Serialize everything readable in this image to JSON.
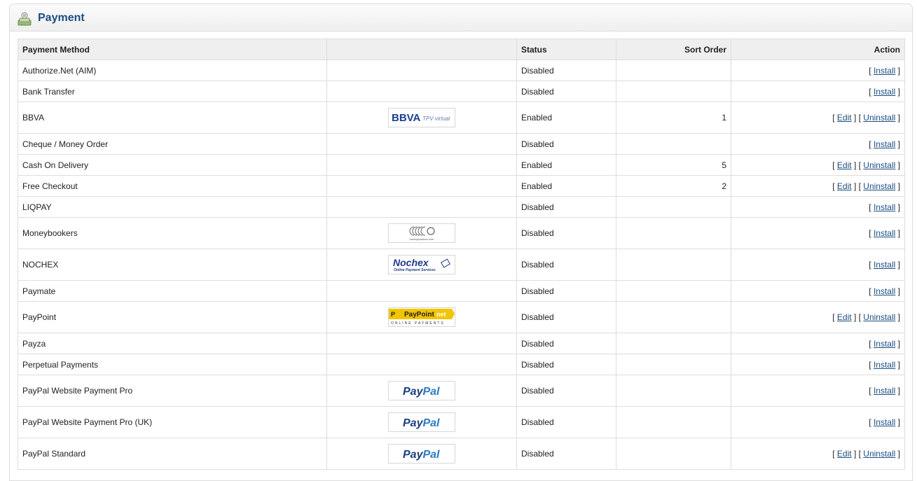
{
  "heading": {
    "title": "Payment"
  },
  "table": {
    "columns": [
      "Payment Method",
      "",
      "Status",
      "Sort Order",
      "Action"
    ]
  },
  "actions": {
    "edit": "Edit",
    "install": "Install",
    "uninstall": "Uninstall"
  },
  "rows": [
    {
      "name": "Authorize.Net (AIM)",
      "logo": null,
      "status": "Disabled",
      "sort": "",
      "installed": false
    },
    {
      "name": "Bank Transfer",
      "logo": null,
      "status": "Disabled",
      "sort": "",
      "installed": false
    },
    {
      "name": "BBVA",
      "logo": "bbva-logo",
      "status": "Enabled",
      "sort": "1",
      "installed": true
    },
    {
      "name": "Cheque / Money Order",
      "logo": null,
      "status": "Disabled",
      "sort": "",
      "installed": false
    },
    {
      "name": "Cash On Delivery",
      "logo": null,
      "status": "Enabled",
      "sort": "5",
      "installed": true
    },
    {
      "name": "Free Checkout",
      "logo": null,
      "status": "Enabled",
      "sort": "2",
      "installed": true
    },
    {
      "name": "LIQPAY",
      "logo": null,
      "status": "Disabled",
      "sort": "",
      "installed": false
    },
    {
      "name": "Moneybookers",
      "logo": "moneybookers-logo",
      "status": "Disabled",
      "sort": "",
      "installed": false
    },
    {
      "name": "NOCHEX",
      "logo": "nochex-logo",
      "status": "Disabled",
      "sort": "",
      "installed": false
    },
    {
      "name": "Paymate",
      "logo": null,
      "status": "Disabled",
      "sort": "",
      "installed": false
    },
    {
      "name": "PayPoint",
      "logo": "paypoint-logo",
      "status": "Disabled",
      "sort": "",
      "installed": true
    },
    {
      "name": "Payza",
      "logo": null,
      "status": "Disabled",
      "sort": "",
      "installed": false
    },
    {
      "name": "Perpetual Payments",
      "logo": null,
      "status": "Disabled",
      "sort": "",
      "installed": false
    },
    {
      "name": "PayPal Website Payment Pro",
      "logo": "paypal-logo",
      "status": "Disabled",
      "sort": "",
      "installed": false
    },
    {
      "name": "PayPal Website Payment Pro (UK)",
      "logo": "paypal-logo",
      "status": "Disabled",
      "sort": "",
      "installed": false
    },
    {
      "name": "PayPal Standard",
      "logo": "paypal-logo",
      "status": "Disabled",
      "sort": "",
      "installed": true
    }
  ],
  "logos": {
    "bbva-logo": {
      "text": "BBVA",
      "subtext": "TPV virtual",
      "color": "#1b3f8f"
    },
    "moneybookers-logo": {
      "text": "moneybookers.com",
      "color": "#555555"
    },
    "nochex-logo": {
      "text": "Nochex",
      "subtext": "Online Payment Services",
      "color": "#1d3a8a"
    },
    "paypoint-logo": {
      "text": "PayPoint",
      "accent": "net",
      "subtext": "ONLINE PAYMENTS",
      "color": "#f2c500"
    },
    "paypal-logo": {
      "text": "PayPal",
      "color": "#1a3f80",
      "accent": "#2a7bc4"
    }
  },
  "colors": {
    "header_title": "#1b4e82",
    "link": "#1b4e82",
    "header_bg": "#efefef",
    "border": "#dddddd"
  }
}
